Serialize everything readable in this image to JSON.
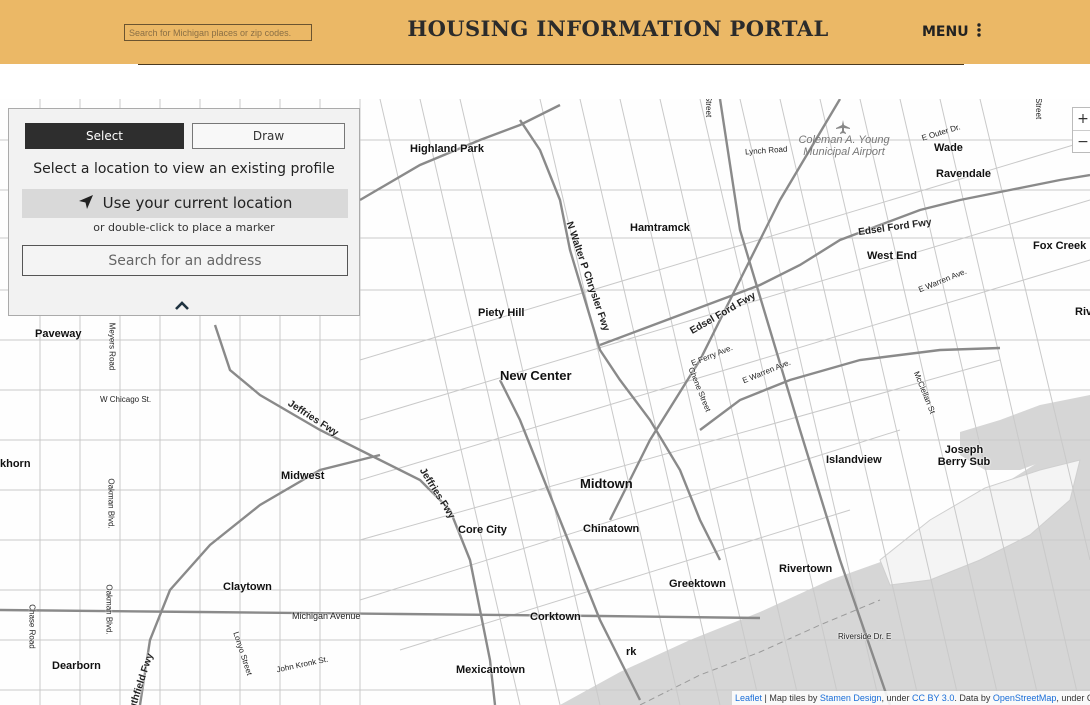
{
  "header": {
    "search_placeholder": "Search for Michigan places or zip codes.",
    "title": "HOUSING INFORMATION PORTAL",
    "menu_label": "MENU",
    "menu_icon": "kebab-vertical-icon"
  },
  "panel": {
    "tabs": [
      {
        "label": "Select",
        "active": true
      },
      {
        "label": "Draw",
        "active": false
      }
    ],
    "prompt": "Select a location to view an existing profile",
    "current_location_label": "Use your current location",
    "current_location_icon": "location-arrow-icon",
    "hint": "or double-click to place a marker",
    "address_placeholder": "Search for an address",
    "collapse_icon": "chevron-up-icon"
  },
  "map": {
    "zoom_in": "+",
    "zoom_out": "−",
    "airport_label": "Coleman A. Young Municipal Airport",
    "airport_icon": "airplane-icon",
    "places": [
      "Highland Park",
      "Wade",
      "Ravendale",
      "Hamtramck",
      "Fox Creek",
      "West End",
      "Piety Hill",
      "Paveway",
      "New Center",
      "Midwest",
      "Midtown",
      "Islandview",
      "Joseph Berry Sub",
      "Core City",
      "Chinatown",
      "Greektown",
      "Rivertown",
      "Claytown",
      "Corktown",
      "Dearborn",
      "Mexicantown",
      "rk",
      "Riv",
      "khorn"
    ],
    "roads": [
      "Lynch Road",
      "E Outer Dr.",
      "Edsel Ford Fwy",
      "E Warren Ave.",
      "N Walter P Chrysler Fwy",
      "Edsel Ford Fwy",
      "E Ferry Ave.",
      "E Warren Ave.",
      "Chene Street",
      "McClellan St",
      "Meyers Road",
      "W Chicago St.",
      "Jeffries Fwy",
      "Jeffries Fwy",
      "Oakman Blvd.",
      "Oakman Blvd.",
      "Michigan Avenue",
      "Chase Road",
      "Lonyo Street",
      "John Kronk St.",
      "Southfield Fwy",
      "Riverside Dr. E",
      "Street",
      "Street"
    ]
  },
  "attribution": {
    "leaflet": "Leaflet",
    "sep1": " | Map tiles by ",
    "stamen": "Stamen Design",
    "sep2": ", under ",
    "cc": "CC BY 3.0",
    "sep3": ". Data by ",
    "osm": "OpenStreetMap",
    "sep4": ", under ODb"
  },
  "colors": {
    "header_bg": "#ebb866",
    "active_tab_bg": "#2e2e2e",
    "panel_bg": "#f2f2f2",
    "water": "#d5d5d5",
    "link": "#1a6ed8"
  }
}
